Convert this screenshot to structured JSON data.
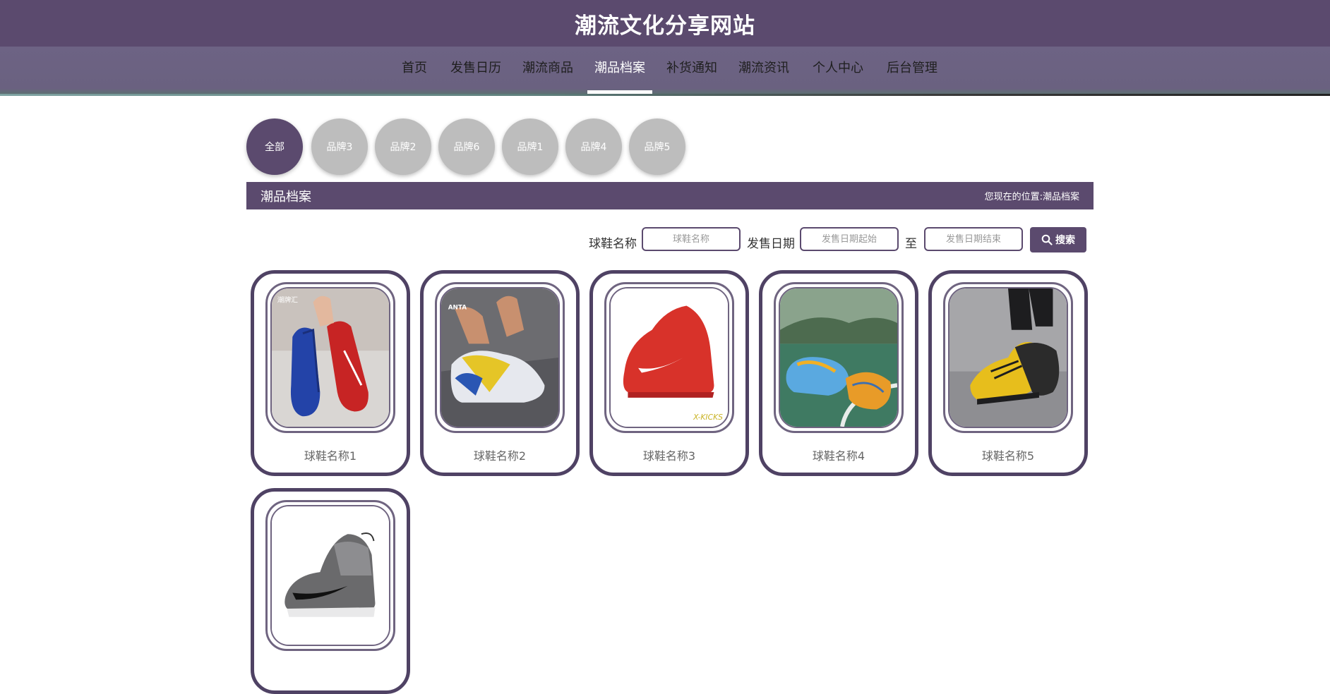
{
  "site": {
    "title": "潮流文化分享网站"
  },
  "nav": {
    "items": [
      {
        "label": "首页"
      },
      {
        "label": "发售日历"
      },
      {
        "label": "潮流商品"
      },
      {
        "label": "潮品档案",
        "active": true
      },
      {
        "label": "补货通知"
      },
      {
        "label": "潮流资讯"
      },
      {
        "label": "个人中心"
      },
      {
        "label": "后台管理"
      }
    ]
  },
  "brands": [
    {
      "label": "全部",
      "active": true
    },
    {
      "label": "品牌3"
    },
    {
      "label": "品牌2"
    },
    {
      "label": "品牌6"
    },
    {
      "label": "品牌1"
    },
    {
      "label": "品牌4"
    },
    {
      "label": "品牌5"
    }
  ],
  "section": {
    "title": "潮品档案",
    "breadcrumb_prefix": "您现在的位置:",
    "breadcrumb_current": "潮品档案"
  },
  "search": {
    "name_label": "球鞋名称",
    "name_placeholder": "球鞋名称",
    "date_label": "发售日期",
    "date_start_placeholder": "发售日期起始",
    "to_label": "至",
    "date_end_placeholder": "发售日期结束",
    "button_label": "搜索"
  },
  "products": [
    {
      "name": "球鞋名称1"
    },
    {
      "name": "球鞋名称2"
    },
    {
      "name": "球鞋名称3"
    },
    {
      "name": "球鞋名称4"
    },
    {
      "name": "球鞋名称5"
    },
    {
      "name": ""
    }
  ],
  "image_text": {
    "watermark_1": "潮牌汇",
    "watermark_2": "ANTA",
    "watermark_3": "X-KICKS"
  },
  "colors": {
    "primary": "#5b4a6e",
    "brand_inactive": "#bdbdbd",
    "card_border": "#4f4264"
  }
}
